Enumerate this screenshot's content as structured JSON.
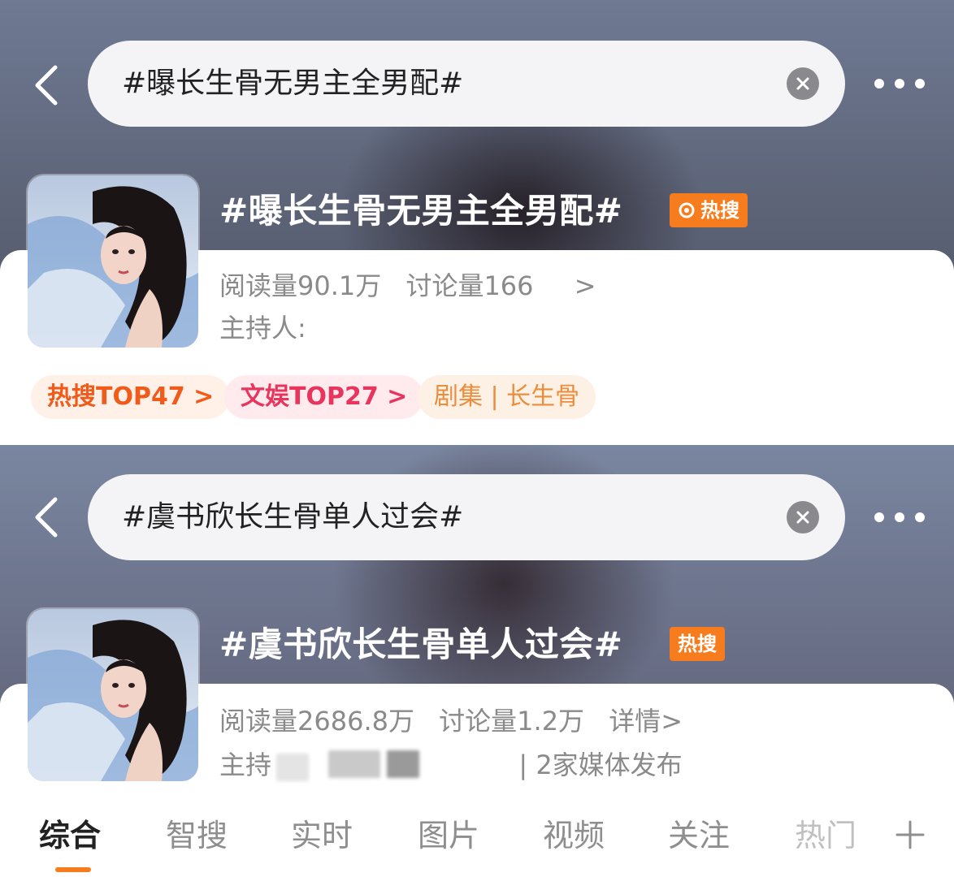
{
  "colors": {
    "accent": "#f77c1e",
    "hot_badge": "#f77c1e",
    "pill_hot_text": "#f05a1a",
    "pill_ent_text": "#e8355d",
    "pill_drama_text": "#ec8d3c"
  },
  "screens": [
    {
      "search_query": "#曝长生骨无男主全男配#",
      "topic_title": "#曝长生骨无男主全男配#",
      "hot_badge": "热搜",
      "stats": {
        "reads": "阅读量90.1万",
        "discussions": "讨论量166",
        "more": ">"
      },
      "host_label": "主持人:",
      "pills": [
        "热搜TOP47 >",
        "文娱TOP27 >",
        "剧集 | 长生骨"
      ]
    },
    {
      "search_query": "#虞书欣长生骨单人过会#",
      "topic_title": "#虞书欣长生骨单人过会#",
      "hot_badge": "热搜",
      "stats": {
        "reads": "阅读量2686.8万",
        "discussions": "讨论量1.2万",
        "more": "详情>"
      },
      "host_label": "主持",
      "host_suffix": "| 2家媒体发布"
    }
  ],
  "tabs": [
    "综合",
    "智搜",
    "实时",
    "图片",
    "视频",
    "关注",
    "热门"
  ],
  "tab_active_index": 0,
  "icons": [
    "back-arrow-icon",
    "clear-icon",
    "more-icon",
    "hot-search-icon",
    "plus-icon"
  ]
}
